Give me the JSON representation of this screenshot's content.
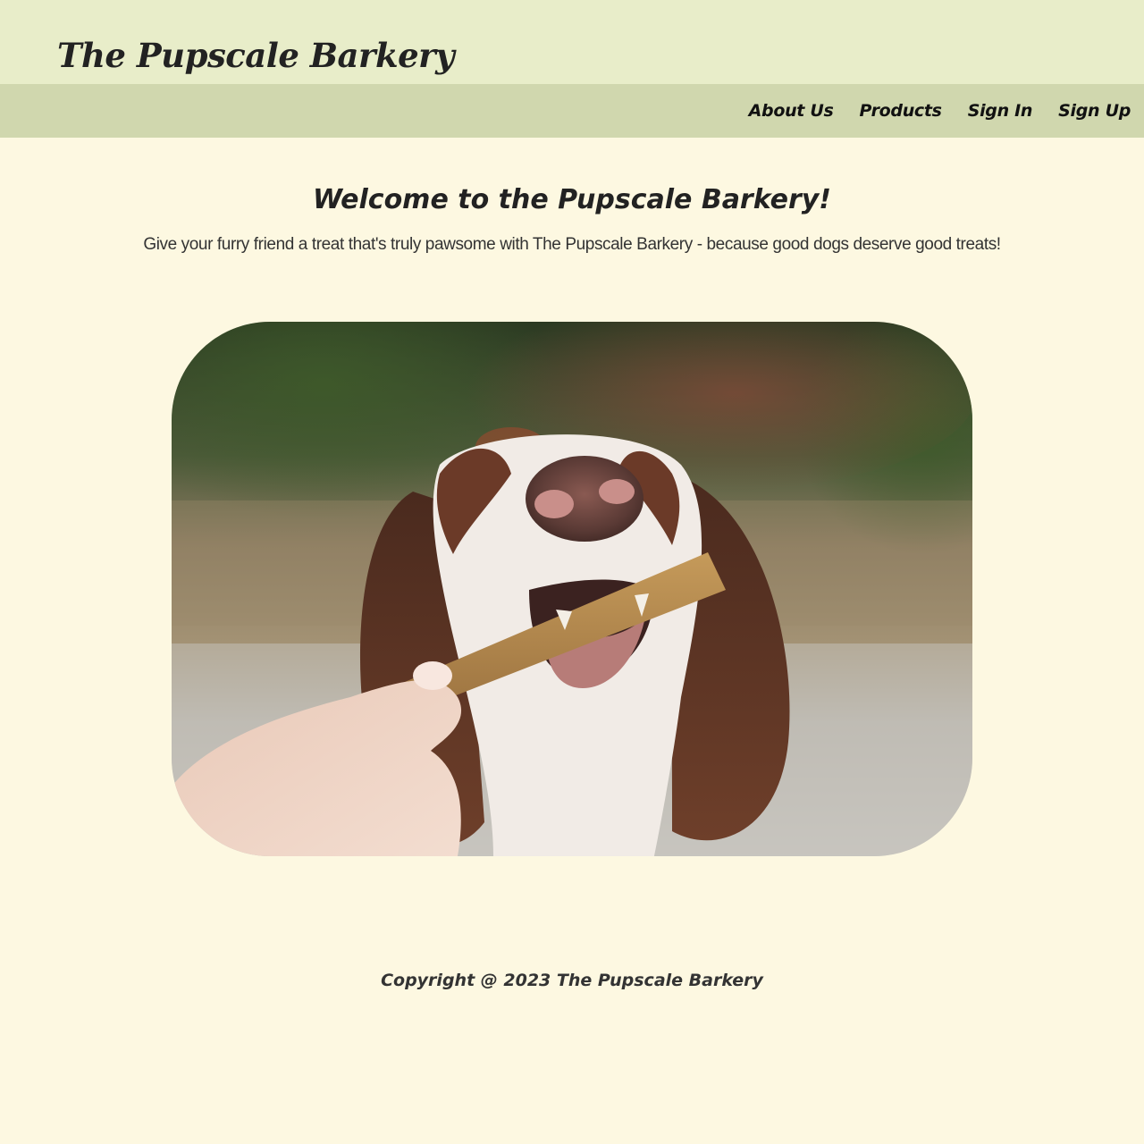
{
  "header": {
    "site_title": "The Pupscale Barkery"
  },
  "nav": {
    "items": [
      {
        "label": "About Us"
      },
      {
        "label": "Products"
      },
      {
        "label": "Sign In"
      },
      {
        "label": "Sign Up"
      }
    ]
  },
  "main": {
    "heading": "Welcome to the Pupscale Barkery!",
    "tagline": "Give your furry friend a treat that's truly pawsome with The Pupscale Barkery - because good dogs deserve good treats!"
  },
  "footer": {
    "copyright": "Copyright @ 2023 The Pupscale Barkery"
  },
  "colors": {
    "page_background": "#fdf8e1",
    "header_background": "#e8edc9",
    "nav_background": "#d0d7ae",
    "text": "#222222"
  }
}
